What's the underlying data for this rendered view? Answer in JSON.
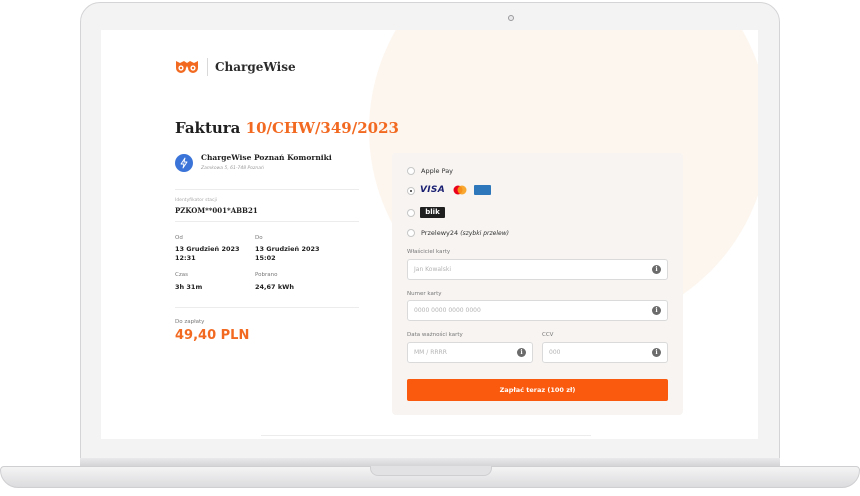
{
  "brand": {
    "name": "ChargeWise",
    "logo_icon": "owl-eyes-icon",
    "accent": "#f26a21"
  },
  "invoice": {
    "title": "Faktura",
    "number": "10/CHW/349/2023"
  },
  "station": {
    "icon": "lightning-icon",
    "name": "ChargeWise Poznań Komorniki",
    "address": "Zamkowa 5, 61-748 Poznań"
  },
  "session": {
    "id_label": "Identyfikator stacji",
    "id_value": "PZKOM**001*ABB21",
    "from_label": "Od",
    "from_date": "13 Grudzień 2023",
    "from_time": "12:31",
    "to_label": "Do",
    "to_date": "13 Grudzień 2023",
    "to_time": "15:02",
    "time_label": "Czas",
    "time_value": "3h 31m",
    "energy_label": "Pobrano",
    "energy_value": "24,67 kWh"
  },
  "total": {
    "label": "Do zapłaty",
    "value": "49,40 PLN"
  },
  "payment": {
    "options": {
      "apple_pay": "Apple Pay",
      "cards_visa": "VISA",
      "blik": "blik",
      "p24": "Przelewy24",
      "p24_note": "(szybki przelew)"
    },
    "selected": "cards",
    "owner_label": "Właściciel karty",
    "owner_placeholder": "Jan Kowalski",
    "card_label": "Numer karty",
    "card_placeholder": "0000 0000 0000 0000",
    "expiry_label": "Data ważności karty",
    "expiry_placeholder": "MM / RRRR",
    "ccv_label": "CCV",
    "ccv_placeholder": "000",
    "info_glyph": "i",
    "submit_label": "Zapłać teraz (100 zł)",
    "button_color": "#fa5a0d"
  }
}
